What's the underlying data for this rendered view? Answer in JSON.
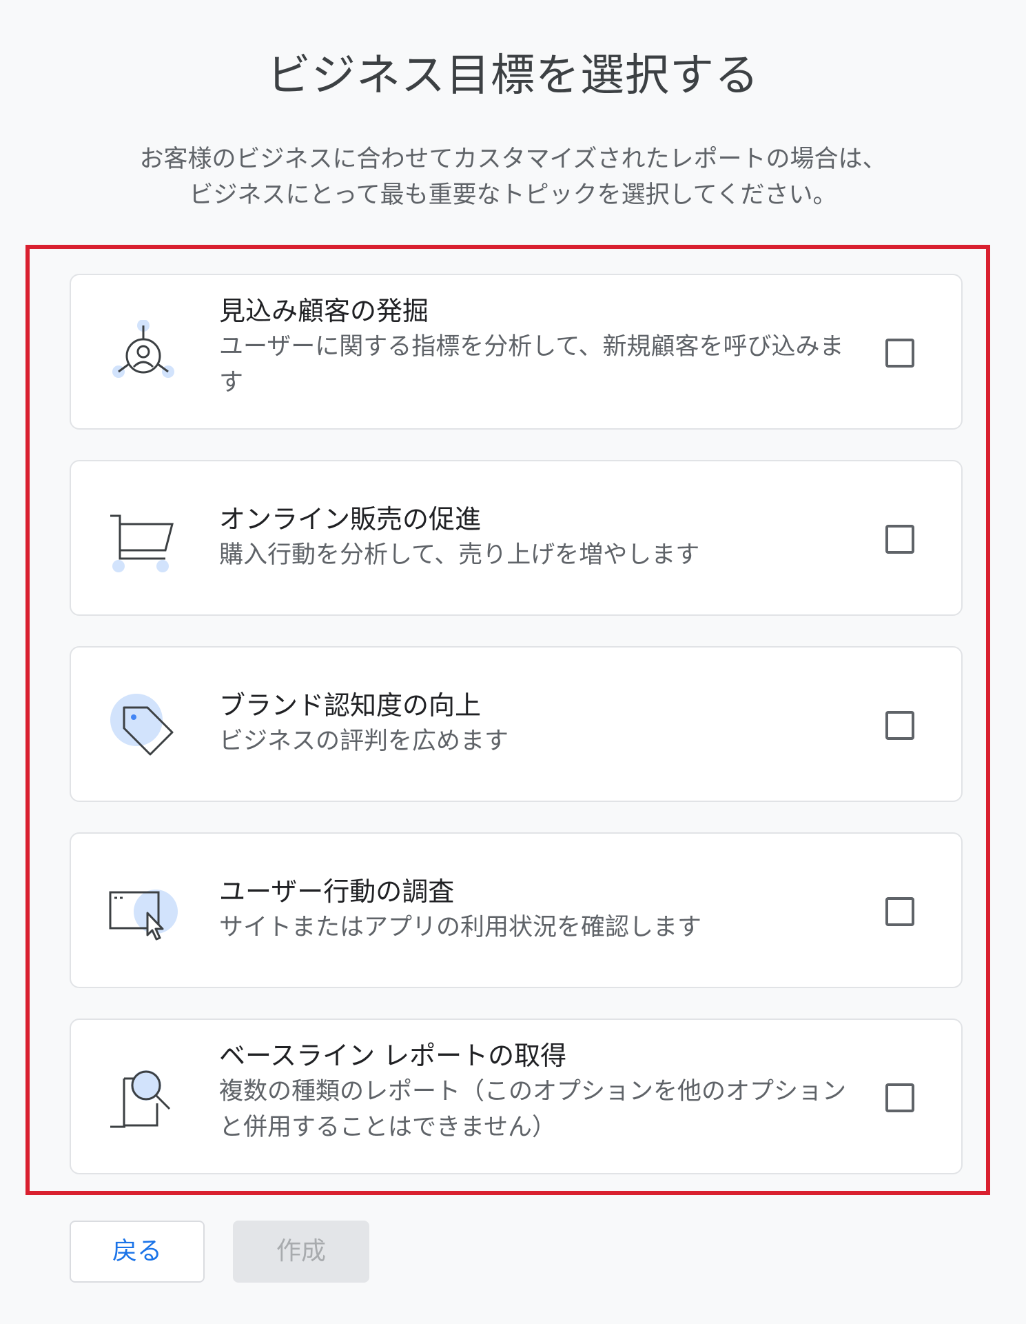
{
  "header": {
    "title": "ビジネス目標を選択する",
    "subtitle_line1": "お客様のビジネスに合わせてカスタマイズされたレポートの場合は、",
    "subtitle_line2": "ビジネスにとって最も重要なトピックを選択してください。"
  },
  "options": [
    {
      "title": "見込み顧客の発掘",
      "desc": "ユーザーに関する指標を分析して、新規顧客を呼び込みます",
      "icon": "user-target-icon",
      "checked": false
    },
    {
      "title": "オンライン販売の促進",
      "desc": "購入行動を分析して、売り上げを増やします",
      "icon": "shopping-cart-icon",
      "checked": false
    },
    {
      "title": "ブランド認知度の向上",
      "desc": "ビジネスの評判を広めます",
      "icon": "price-tag-icon",
      "checked": false
    },
    {
      "title": "ユーザー行動の調査",
      "desc": "サイトまたはアプリの利用状況を確認します",
      "icon": "browser-cursor-icon",
      "checked": false
    },
    {
      "title": "ベースライン レポートの取得",
      "desc": "複数の種類のレポート（このオプションを他のオプションと併用することはできません）",
      "icon": "document-search-icon",
      "checked": false
    }
  ],
  "buttons": {
    "back": "戻る",
    "create": "作成"
  },
  "colors": {
    "highlight_border": "#d9202f",
    "accent_blue": "#1a73e8",
    "icon_bubble": "#d2e3fc"
  }
}
